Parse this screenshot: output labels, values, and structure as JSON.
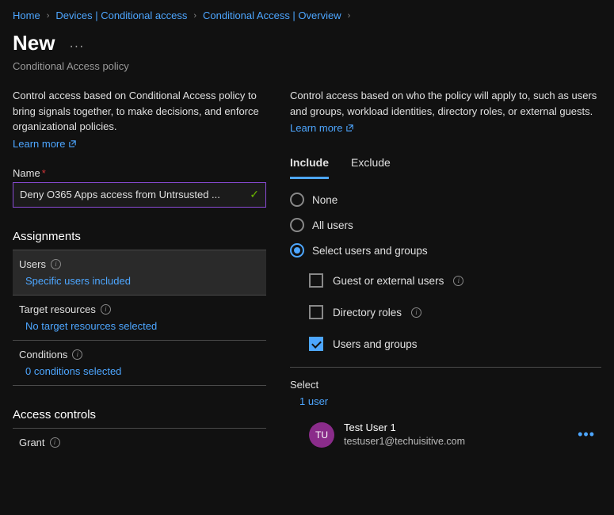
{
  "breadcrumb": [
    "Home",
    "Devices | Conditional access",
    "Conditional Access | Overview"
  ],
  "title": "New",
  "subtitle": "Conditional Access policy",
  "left": {
    "intro": "Control access based on Conditional Access policy to bring signals together, to make decisions, and enforce organizational policies.",
    "learn_more": "Learn more",
    "name_label": "Name",
    "name_value": "Deny O365 Apps access from Untrsusted ...",
    "assignments_heading": "Assignments",
    "users": {
      "label": "Users",
      "value": "Specific users included"
    },
    "target": {
      "label": "Target resources",
      "value": "No target resources selected"
    },
    "conditions": {
      "label": "Conditions",
      "value": "0 conditions selected"
    },
    "access_controls_heading": "Access controls",
    "grant": {
      "label": "Grant"
    }
  },
  "right": {
    "intro": "Control access based on who the policy will apply to, such as users and groups, workload identities, directory roles, or external guests.",
    "learn_more": "Learn more",
    "tabs": {
      "include": "Include",
      "exclude": "Exclude"
    },
    "radios": {
      "none": "None",
      "all": "All users",
      "select": "Select users and groups"
    },
    "checks": {
      "guest": "Guest or external users",
      "roles": "Directory roles",
      "users_groups": "Users and groups"
    },
    "select_label": "Select",
    "select_count": "1 user",
    "user": {
      "initials": "TU",
      "name": "Test User 1",
      "email": "testuser1@techuisitive.com"
    }
  }
}
